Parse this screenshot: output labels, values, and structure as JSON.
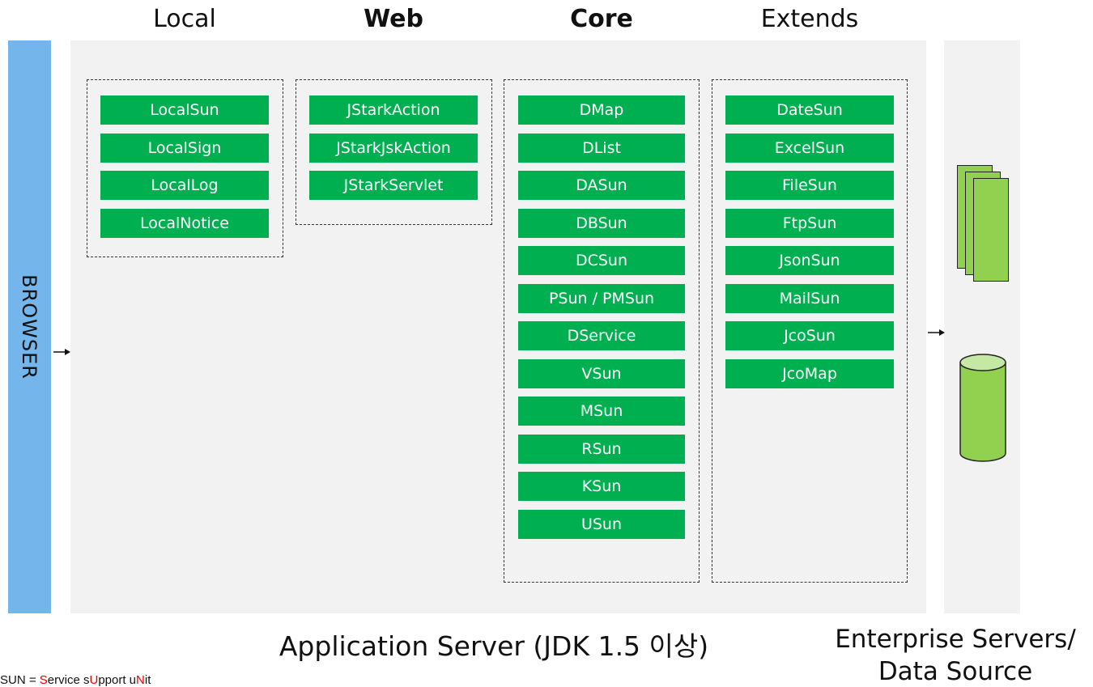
{
  "columns": {
    "local": "Local",
    "web": "Web",
    "core": "Core",
    "extends": "Extends"
  },
  "browser_label": "BROWSER",
  "groups": {
    "local": [
      "LocalSun",
      "LocalSign",
      "LocalLog",
      "LocalNotice"
    ],
    "web": [
      "JStarkAction",
      "JStarkJskAction",
      "JStarkServlet"
    ],
    "core": [
      "DMap",
      "DList",
      "DASun",
      "DBSun",
      "DCSun",
      "PSun / PMSun",
      "DService",
      "VSun",
      "MSun",
      "RSun",
      "KSun",
      "USun"
    ],
    "extends": [
      "DateSun",
      "ExcelSun",
      "FileSun",
      "FtpSun",
      "JsonSun",
      "MailSun",
      "JcoSun",
      "JcoMap"
    ]
  },
  "captions": {
    "app_server": "Application Server (JDK 1.5 이상)",
    "enterprise_line1": "Enterprise Servers/",
    "enterprise_line2": "Data Source"
  },
  "footnote": {
    "prefix": "SUN = ",
    "parts": [
      {
        "red": "S",
        "rest": "ervice s"
      },
      {
        "red": "U",
        "rest": "pport u"
      },
      {
        "red": "N",
        "rest": "it"
      }
    ]
  },
  "colors": {
    "browser": "#74b6ec",
    "panel": "#f2f2f2",
    "module": "#00b050",
    "document_icon": "#92d050",
    "emphasis": "#e00000"
  },
  "icons": [
    "document-stack-icon",
    "database-icon",
    "arrow-right-icon"
  ]
}
